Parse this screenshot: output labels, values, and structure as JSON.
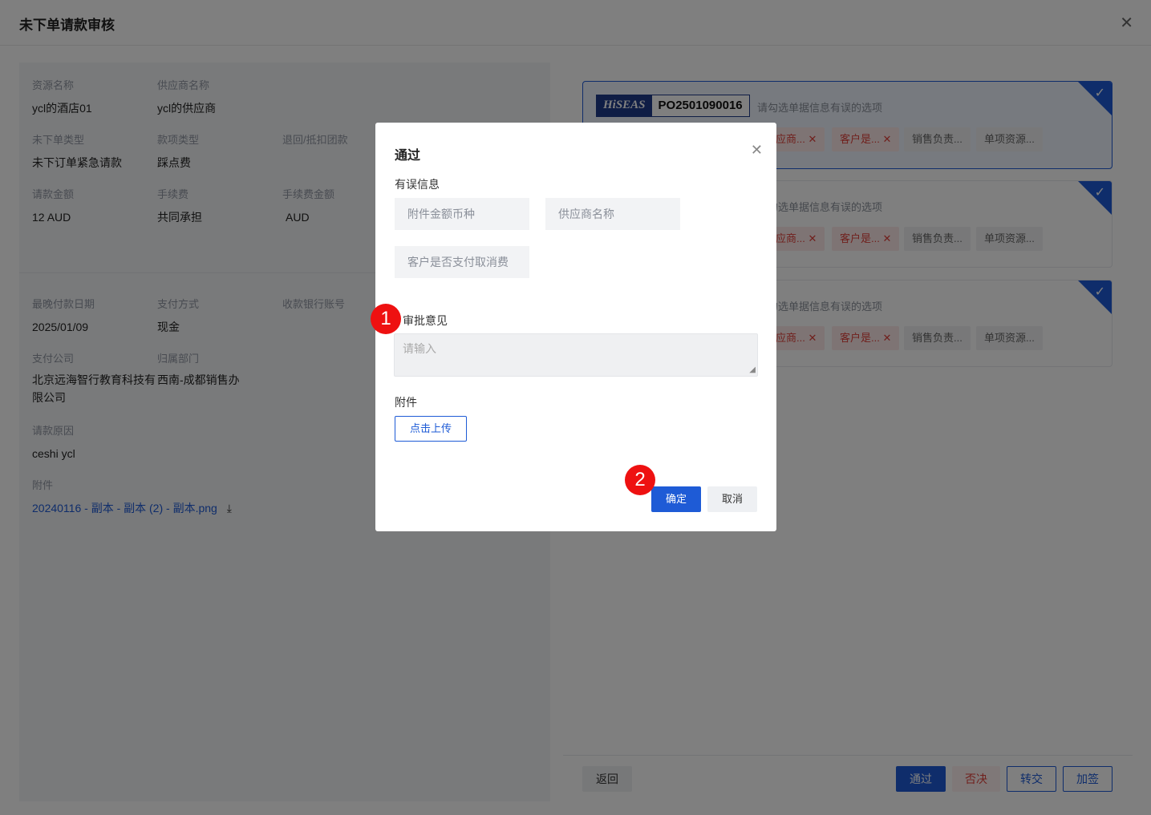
{
  "window": {
    "title": "未下单请款审核",
    "close_icon": "✕"
  },
  "info": {
    "resource_name": {
      "label": "资源名称",
      "value": "ycl的酒店01"
    },
    "supplier_name": {
      "label": "供应商名称",
      "value": "ycl的供应商"
    },
    "unordered_type": {
      "label": "未下单类型",
      "value": "未下订单紧急请款"
    },
    "payment_type": {
      "label": "款项类型",
      "value": "踩点费"
    },
    "return_offset": {
      "label": "退回/抵扣团款"
    },
    "amount": {
      "label": "请款金额",
      "value": "12 AUD"
    },
    "fee": {
      "label": "手续费",
      "value": "共同承担"
    },
    "fee_amount": {
      "label": "手续费金额",
      "value": "AUD"
    },
    "deadline": {
      "label": "最晚付款日期",
      "value": "2025/01/09"
    },
    "pay_method": {
      "label": "支付方式",
      "value": "现金"
    },
    "bank_account": {
      "label": "收款银行账号"
    },
    "pay_company": {
      "label": "支付公司",
      "value_line1": "北京远海智行教育科技有",
      "value_line2": "限公司"
    },
    "department": {
      "label": "归属部门",
      "value": "西南-成都销售办"
    },
    "reason": {
      "label": "请款原因",
      "value": "ceshi ycl"
    },
    "attachment": {
      "label": "附件",
      "file": "20240116 - 副本 - 副本 (2) - 副本.png",
      "download_icon": "⤓"
    }
  },
  "cards": [
    {
      "logo": "HiSEAS",
      "po": "PO2501090016",
      "hint": "请勾选单据信息有误的选项",
      "tags": [
        "供应商...",
        "客户是...",
        "销售负责...",
        "单项资源..."
      ]
    },
    {
      "hint": "请勾选单据信息有误的选项",
      "tags": [
        "供应商...",
        "客户是...",
        "销售负责...",
        "单项资源..."
      ]
    },
    {
      "hint": "请勾选单据信息有误的选项",
      "tags": [
        "供应商...",
        "客户是...",
        "销售负责...",
        "单项资源..."
      ]
    }
  ],
  "footer": {
    "back": "返回",
    "approve": "通过",
    "reject": "否决",
    "transfer": "转交",
    "add_sign": "加签"
  },
  "modal": {
    "title": "通过",
    "close_icon": "✕",
    "error_info_label": "有误信息",
    "options": [
      "附件金额币种",
      "供应商名称",
      "客户是否支付取消费"
    ],
    "opinion_label": "审批意见",
    "opinion_placeholder": "请输入",
    "attachment_label": "附件",
    "upload": "点击上传",
    "confirm": "确定",
    "cancel": "取消"
  },
  "badges": [
    "1",
    "2"
  ],
  "colors": {
    "primary": "#1e5bd6",
    "error": "#e0403a",
    "badge": "#ee1111"
  }
}
